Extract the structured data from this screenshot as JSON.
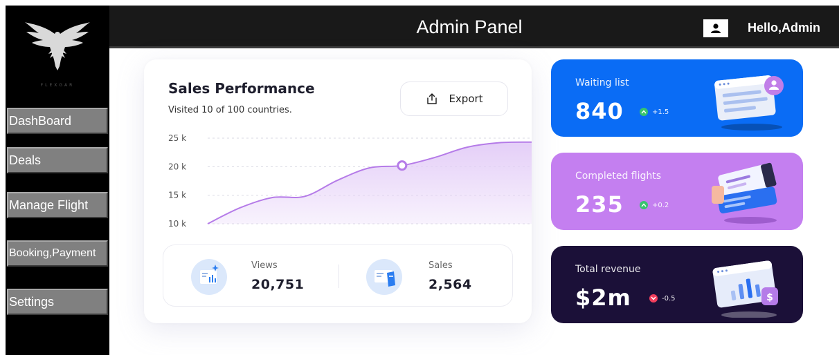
{
  "header": {
    "title": "Admin Panel",
    "greeting": "Hello,Admin"
  },
  "sidebar": {
    "logo_caption": "FLEXGAR",
    "items": [
      {
        "label": "DashBoard"
      },
      {
        "label": "Deals"
      },
      {
        "label": "Manage Flight"
      },
      {
        "label": "Booking,Payment"
      },
      {
        "label": "Settings"
      }
    ]
  },
  "sales": {
    "title": "Sales Performance",
    "subtitle": "Visited 10 of 100 countries.",
    "export_label": "Export",
    "views": {
      "label": "Views",
      "value": "20,751"
    },
    "sales": {
      "label": "Sales",
      "value": "2,564"
    }
  },
  "chart_data": {
    "type": "area",
    "title": "",
    "xlabel": "",
    "ylabel": "",
    "ylim": [
      10,
      25
    ],
    "yticks": [
      "25 k",
      "20 k",
      "15 k",
      "10 k"
    ],
    "x": [
      0,
      1,
      2,
      3,
      4,
      5,
      6,
      7,
      8,
      9,
      10
    ],
    "y": [
      10,
      12.8,
      14.6,
      14.8,
      17.6,
      19.8,
      20.2,
      21.6,
      23.4,
      24.2,
      24.3
    ],
    "highlight_index": 6,
    "line_color": "#b57be8",
    "fill_color": "#e3ccf7",
    "grid": true
  },
  "cards": [
    {
      "label": "Waiting list",
      "value": "840",
      "change": "+1.5",
      "direction": "up",
      "bg": "#0a6cf5",
      "indicator": "#36c46d"
    },
    {
      "label": "Completed flights",
      "value": "235",
      "change": "+0.2",
      "direction": "up",
      "bg": "#c47ff0",
      "indicator": "#36c46d"
    },
    {
      "label": "Total revenue",
      "value": "$2m",
      "change": "-0.5",
      "direction": "down",
      "bg": "#1b1038",
      "indicator": "#f23e5d"
    }
  ]
}
